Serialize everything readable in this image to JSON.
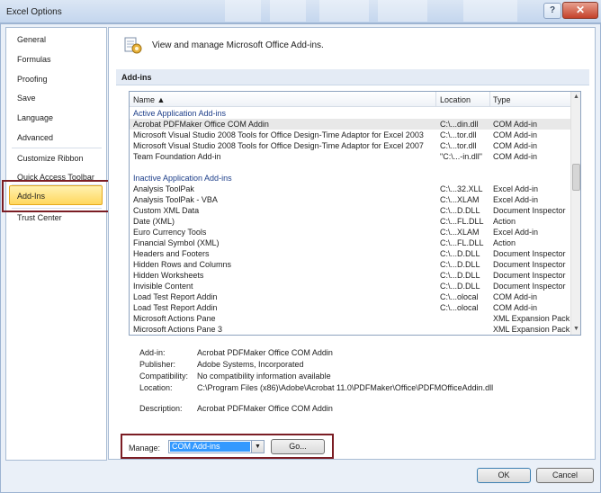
{
  "window": {
    "title": "Excel Options",
    "help_label": "?",
    "close_label": "✕"
  },
  "sidebar": {
    "items": [
      {
        "label": "General"
      },
      {
        "label": "Formulas"
      },
      {
        "label": "Proofing"
      },
      {
        "label": "Save"
      },
      {
        "label": "Language"
      },
      {
        "label": "Advanced"
      },
      {
        "label": "Customize Ribbon"
      },
      {
        "label": "Quick Access Toolbar"
      },
      {
        "label": "Add-Ins",
        "selected": true
      },
      {
        "label": "Trust Center"
      }
    ]
  },
  "header": {
    "icon": "addins-gear-icon",
    "text": "View and manage Microsoft Office Add-ins."
  },
  "section": {
    "title": "Add-ins"
  },
  "list": {
    "columns": {
      "name": "Name ▲",
      "location": "Location",
      "type": "Type"
    },
    "groups": [
      {
        "title": "Active Application Add-ins",
        "rows": [
          {
            "name": "Acrobat PDFMaker Office COM Addin",
            "location": "C:\\...din.dll",
            "type": "COM Add-in",
            "selected": true
          },
          {
            "name": "Microsoft Visual Studio 2008 Tools for Office Design-Time Adaptor for Excel 2003",
            "location": "C:\\...tor.dll",
            "type": "COM Add-in"
          },
          {
            "name": "Microsoft Visual Studio 2008 Tools for Office Design-Time Adaptor for Excel 2007",
            "location": "C:\\...tor.dll",
            "type": "COM Add-in"
          },
          {
            "name": "Team Foundation Add-in",
            "location": "\"C:\\...-in.dll\"",
            "type": "COM Add-in"
          }
        ]
      },
      {
        "title": "Inactive Application Add-ins",
        "rows": [
          {
            "name": "Analysis ToolPak",
            "location": "C:\\...32.XLL",
            "type": "Excel Add-in"
          },
          {
            "name": "Analysis ToolPak - VBA",
            "location": "C:\\...XLAM",
            "type": "Excel Add-in"
          },
          {
            "name": "Custom XML Data",
            "location": "C:\\...D.DLL",
            "type": "Document Inspector"
          },
          {
            "name": "Date (XML)",
            "location": "C:\\...FL.DLL",
            "type": "Action"
          },
          {
            "name": "Euro Currency Tools",
            "location": "C:\\...XLAM",
            "type": "Excel Add-in"
          },
          {
            "name": "Financial Symbol (XML)",
            "location": "C:\\...FL.DLL",
            "type": "Action"
          },
          {
            "name": "Headers and Footers",
            "location": "C:\\...D.DLL",
            "type": "Document Inspector"
          },
          {
            "name": "Hidden Rows and Columns",
            "location": "C:\\...D.DLL",
            "type": "Document Inspector"
          },
          {
            "name": "Hidden Worksheets",
            "location": "C:\\...D.DLL",
            "type": "Document Inspector"
          },
          {
            "name": "Invisible Content",
            "location": "C:\\...D.DLL",
            "type": "Document Inspector"
          },
          {
            "name": "Load Test Report Addin",
            "location": "C:\\...olocal",
            "type": "COM Add-in"
          },
          {
            "name": "Load Test Report Addin",
            "location": "C:\\...olocal",
            "type": "COM Add-in"
          },
          {
            "name": "Microsoft Actions Pane",
            "location": "",
            "type": "XML Expansion Pack"
          },
          {
            "name": "Microsoft Actions Pane 3",
            "location": "",
            "type": "XML Expansion Pack"
          }
        ]
      }
    ]
  },
  "details": {
    "addin_label": "Add-in:",
    "addin_value": "Acrobat PDFMaker Office COM Addin",
    "publisher_label": "Publisher:",
    "publisher_value": "Adobe Systems, Incorporated",
    "compat_label": "Compatibility:",
    "compat_value": "No compatibility information available",
    "location_label": "Location:",
    "location_value": "C:\\Program Files (x86)\\Adobe\\Acrobat 11.0\\PDFMaker\\Office\\PDFMOfficeAddin.dll",
    "description_label": "Description:",
    "description_value": "Acrobat PDFMaker Office COM Addin"
  },
  "manage": {
    "label": "Manage:",
    "value": "COM Add-ins",
    "go_label": "Go..."
  },
  "footer": {
    "ok_label": "OK",
    "cancel_label": "Cancel"
  },
  "colors": {
    "highlight_box": "#7b1d24",
    "selected_nav": "#ffd75e",
    "combo_selection": "#3399ff"
  }
}
